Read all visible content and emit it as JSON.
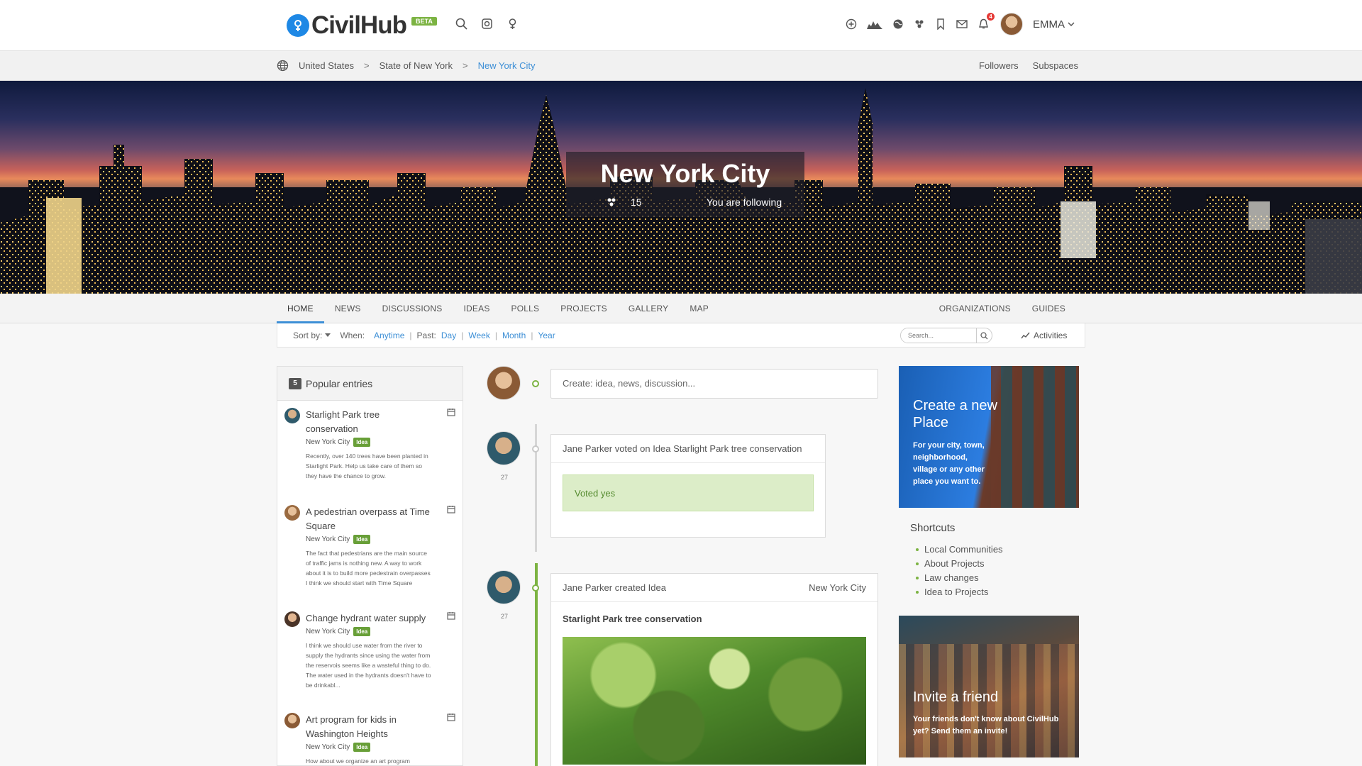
{
  "brand": {
    "name": "CivilHub",
    "beta": "BETA"
  },
  "user": {
    "name": "EMMA"
  },
  "notifications": {
    "count": "4"
  },
  "breadcrumb": {
    "items": [
      "United States",
      "State of New York",
      "New York City"
    ],
    "separator": ">",
    "right": [
      "Followers",
      "Subspaces"
    ]
  },
  "hero": {
    "title": "New York City",
    "members": "15",
    "follow_status": "You are following"
  },
  "tabs": {
    "left": [
      "HOME",
      "NEWS",
      "DISCUSSIONS",
      "IDEAS",
      "POLLS",
      "PROJECTS",
      "GALLERY",
      "MAP"
    ],
    "right": [
      "ORGANIZATIONS",
      "GUIDES"
    ],
    "active": "HOME"
  },
  "filters": {
    "sort_label": "Sort by:",
    "when_label": "When:",
    "anytime": "Anytime",
    "past_label": "Past:",
    "day": "Day",
    "week": "Week",
    "month": "Month",
    "year": "Year",
    "search_placeholder": "Search...",
    "activities": "Activities"
  },
  "popular": {
    "count": "5",
    "title": "Popular entries",
    "entries": [
      {
        "title": "Starlight Park tree conservation",
        "location": "New York City",
        "tag": "Idea",
        "desc": "Recently, over 140 trees have been planted  in Starlight Park. Help us take care of them so they have the chance to grow."
      },
      {
        "title": "A pedestrian overpass at Time Square",
        "location": "New York City",
        "tag": "Idea",
        "desc": "The fact that pedestrians are the main source of traffic jams is nothing new. A way to work about it is to build more pedestrain overpasses I think we should start with Time Square"
      },
      {
        "title": "Change hydrant water supply",
        "location": "New York City",
        "tag": "Idea",
        "desc": "I think we should use water from the river to supply the hydrants since using the water from the reservois seems like a wasteful thing to do. The water used in the hydrants doesn't have to be drinkabl..."
      },
      {
        "title": "Art program for kids in Washington Heights",
        "location": "New York City",
        "tag": "Idea",
        "desc": "How about we organize an art program"
      }
    ]
  },
  "timeline": {
    "create_placeholder": "Create: idea, news, discussion...",
    "items": [
      {
        "num": "27",
        "head": "Jane Parker voted on Idea Starlight Park tree conservation",
        "vote": "Voted yes"
      },
      {
        "num": "27",
        "head": "Jane Parker created Idea",
        "place": "New York City",
        "title": "Starlight Park tree conservation"
      }
    ]
  },
  "promo1": {
    "title": "Create a new Place",
    "sub": "For your city, town, neighborhood, village or any other place you want to."
  },
  "shortcuts": {
    "title": "Shortcuts",
    "items": [
      "Local Communities",
      "About Projects",
      "Law changes",
      "Idea to Projects"
    ]
  },
  "promo2": {
    "title": "Invite a friend",
    "sub": "Your friends don't know about CivilHub yet? Send them an invite!"
  },
  "colors": {
    "accent": "#3d8fd6",
    "green": "#7cb342",
    "logo_blue": "#1e88e5"
  }
}
